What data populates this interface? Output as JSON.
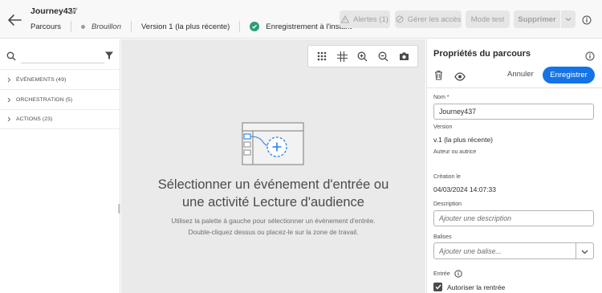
{
  "header": {
    "back_icon": "arrow-left-icon",
    "journey_name": "Journey437",
    "edit_icon": "pencil-icon",
    "breadcrumb": "Parcours",
    "status": "Brouillon",
    "version": "Version 1 (la plus récente)",
    "save_status": "Enregistrement à l'instant",
    "save_status_color": "#2d9d78",
    "buttons": {
      "alerts": "Alertes (1)",
      "access": "Gérer les accès",
      "test": "Mode test",
      "delete": "Supprimer"
    }
  },
  "palette": {
    "search_placeholder": "",
    "categories": [
      {
        "label": "ÉVÉNEMENTS (49)"
      },
      {
        "label": "ORCHESTRATION (5)"
      },
      {
        "label": "ACTIONS (23)"
      }
    ]
  },
  "canvas": {
    "toolbar_icons": [
      "grid-icon",
      "fit-canvas-icon",
      "zoom-in-icon",
      "zoom-out-icon",
      "camera-icon"
    ],
    "empty_title_line1": "Sélectionner un événement d'entrée ou",
    "empty_title_line2": "une activité Lecture d'audience",
    "empty_desc_line1": "Utilisez la palette à gauche pour sélectionner un événement d'entrée.",
    "empty_desc_line2": "Double-cliquez dessus ou placez-le sur la zone de travail."
  },
  "properties": {
    "title": "Propriétés du parcours",
    "cancel_label": "Annuler",
    "save_label": "Enregistrer",
    "accent_color": "#1473e6",
    "name_label": "Nom",
    "name_required_mark": "*",
    "name_value": "Journey437",
    "version_label": "Version",
    "version_value": "v.1 (la plus récente)",
    "author_label": "Auteur ou autrice",
    "author_value": "",
    "created_label": "Création le",
    "created_value": "04/03/2024 14:07:33",
    "description_label": "Description",
    "description_placeholder": "Ajouter une description",
    "tags_label": "Balises",
    "tags_placeholder": "Ajouter une balise...",
    "entry_label": "Entrée",
    "allow_reentry_label": "Autoriser la rentrée",
    "allow_reentry_checked": true
  }
}
